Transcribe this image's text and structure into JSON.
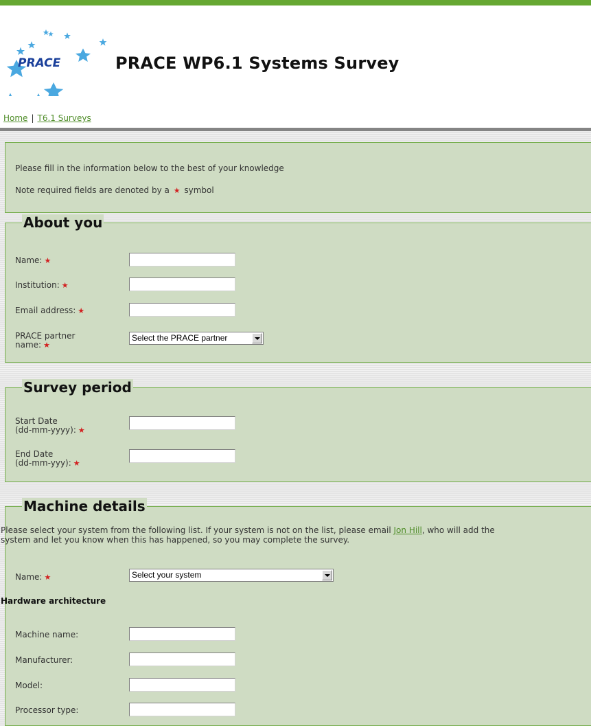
{
  "site": {
    "logo_text": "PRACE",
    "title": "PRACE WP6.1 Systems Survey"
  },
  "nav": {
    "home": "Home",
    "separator": "|",
    "surveys": "T6.1 Surveys"
  },
  "intro": {
    "line1": "Please fill in the information below to the best of your knowledge",
    "line2_before": "Note required fields are denoted by a",
    "line2_symbol": "★",
    "line2_after": "symbol"
  },
  "required_symbol": "★",
  "about": {
    "legend": "About you",
    "name_label": "Name:",
    "institution_label": "Institution:",
    "email_label": "Email address:",
    "partner_label_1": "PRACE partner",
    "partner_label_2": "name:",
    "partner_select": "Select the PRACE partner"
  },
  "period": {
    "legend": "Survey period",
    "start_label_1": "Start Date",
    "start_label_2": "(dd-mm-yyyy):",
    "end_label_1": "End Date",
    "end_label_2": "(dd-mm-yyy):"
  },
  "machine": {
    "legend": "Machine details",
    "desc_part1": "Please select your system from the following list. If your system is not on the list, please email",
    "desc_link": "Jon Hill",
    "desc_part2": ", who will add the",
    "desc_line2": "system and let you know when this has happened, so you may complete the survey.",
    "name_label": "Name:",
    "system_select": "Select your system",
    "hw_heading": "Hardware architecture",
    "machine_name_label": "Machine name:",
    "manufacturer_label": "Manufacturer:",
    "model_label": "Model:",
    "processor_label": "Processor type:"
  },
  "colors": {
    "accent_green": "#66a832",
    "panel_bg": "#cfdcc3",
    "panel_border": "#74ad4b",
    "link": "#4e8c27",
    "required": "#d21f1f"
  }
}
